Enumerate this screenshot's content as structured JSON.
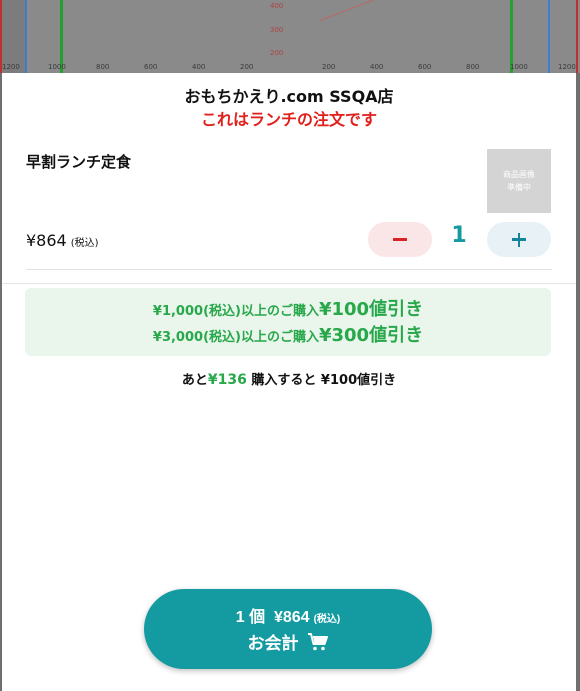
{
  "background_chart": {
    "x_ticks": [
      "1200",
      "1000",
      "800",
      "600",
      "400",
      "200",
      "200",
      "400",
      "600",
      "800",
      "1000",
      "1200"
    ],
    "y_ticks": [
      "400",
      "300",
      "200"
    ]
  },
  "header": {
    "shop_name": "おもちかえり.com SSQA店",
    "lunch_notice": "これはランチの注文です"
  },
  "item": {
    "name": "早割ランチ定食",
    "price": "¥864",
    "tax_label": "(税込)",
    "thumbnail_text_1": "商品画像",
    "thumbnail_text_2": "準備中",
    "quantity": "1"
  },
  "promo": {
    "line1_prefix": "¥1,000(税込)以上のご購入",
    "line1_discount": "¥100値引き",
    "line2_prefix": "¥3,000(税込)以上のご購入",
    "line2_discount": "¥300値引き"
  },
  "remaining": {
    "prefix": "あと",
    "amount": "¥136",
    "suffix": " 購入すると ¥100値引き"
  },
  "checkout": {
    "count": "1 個",
    "total": "¥864",
    "tax_label": "(税込)",
    "label": "お会計",
    "icon": "cart-icon"
  },
  "colors": {
    "accent_teal": "#149ba1",
    "alert_red": "#e0201c",
    "promo_green": "#27a84a",
    "promo_bg": "#eaf5ec"
  }
}
